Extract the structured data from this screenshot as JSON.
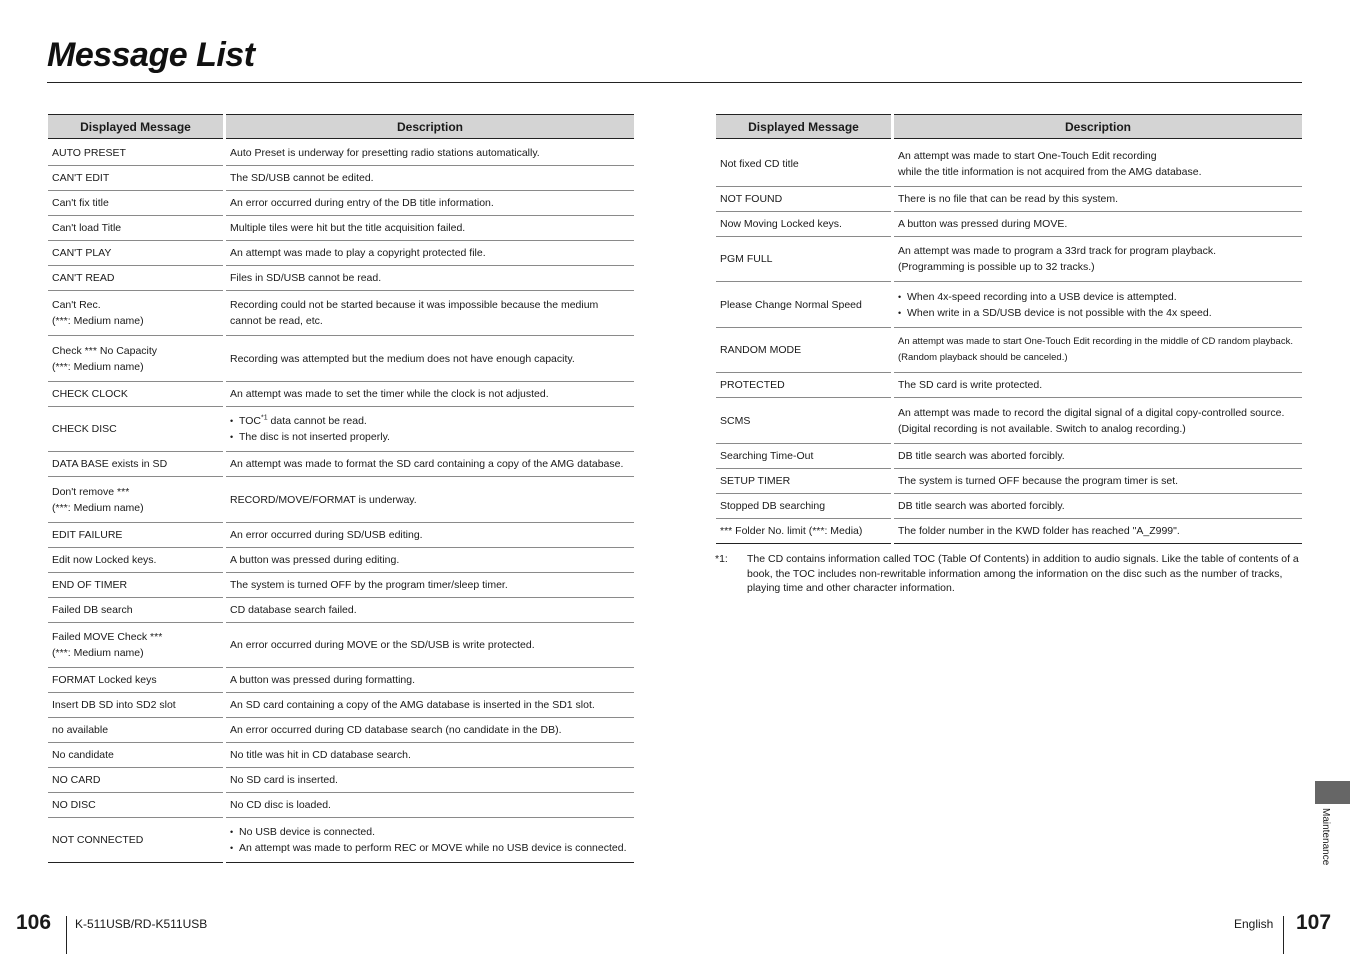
{
  "page": {
    "title": "Message List"
  },
  "table_headers": {
    "message": "Displayed Message",
    "description": "Description"
  },
  "left_table": [
    {
      "message": [
        "AUTO PRESET"
      ],
      "description": [
        "Auto Preset is underway for presetting radio stations automatically."
      ]
    },
    {
      "message": [
        "CAN'T EDIT"
      ],
      "description": [
        "The SD/USB cannot be edited."
      ]
    },
    {
      "message": [
        "Can't fix title"
      ],
      "description": [
        "An error occurred during entry of the DB title information."
      ]
    },
    {
      "message": [
        "Can't load Title"
      ],
      "description": [
        "Multiple tiles were hit but the title acquisition failed."
      ]
    },
    {
      "message": [
        "CAN'T PLAY"
      ],
      "description": [
        "An attempt was made to play a copyright protected file."
      ]
    },
    {
      "message": [
        "CAN'T READ"
      ],
      "description": [
        "Files in SD/USB cannot be read."
      ]
    },
    {
      "message": [
        "Can't Rec.",
        "(***: Medium name)"
      ],
      "description": [
        "Recording could not be started because it was impossible because the medium",
        "cannot be read, etc."
      ]
    },
    {
      "message": [
        "Check *** No Capacity",
        "(***: Medium name)"
      ],
      "description": [
        "Recording was attempted but the medium does not have enough capacity."
      ]
    },
    {
      "message": [
        "CHECK CLOCK"
      ],
      "description": [
        "An attempt was made to set the timer while the clock is not adjusted."
      ]
    },
    {
      "message": [
        "CHECK DISC"
      ],
      "bullets": true,
      "description": [
        "TOC|*1| data cannot be read.",
        "The disc is not inserted properly."
      ]
    },
    {
      "message": [
        "DATA BASE exists in SD"
      ],
      "description": [
        "An attempt was made to format the SD card containing a copy of the AMG database."
      ]
    },
    {
      "message": [
        "Don't remove ***",
        "(***: Medium name)"
      ],
      "description": [
        "RECORD/MOVE/FORMAT is underway."
      ]
    },
    {
      "message": [
        "EDIT FAILURE"
      ],
      "description": [
        "An error occurred during SD/USB editing."
      ]
    },
    {
      "message": [
        "Edit now Locked keys."
      ],
      "description": [
        "A button was pressed during editing."
      ]
    },
    {
      "message": [
        "END OF TIMER"
      ],
      "description": [
        "The system is turned OFF by the program timer/sleep timer."
      ]
    },
    {
      "message": [
        "Failed DB search"
      ],
      "description": [
        "CD database search failed."
      ]
    },
    {
      "message": [
        "Failed MOVE Check ***",
        "(***: Medium name)"
      ],
      "description": [
        "An error occurred during MOVE or the SD/USB is write protected."
      ]
    },
    {
      "message": [
        "FORMAT Locked keys"
      ],
      "description": [
        "A button was pressed during formatting."
      ]
    },
    {
      "message": [
        "Insert DB SD into SD2 slot"
      ],
      "description": [
        "An SD card containing a copy of the AMG database is inserted in the SD1 slot."
      ]
    },
    {
      "message": [
        "no available"
      ],
      "description": [
        "An error occurred during CD database search (no candidate in the DB)."
      ]
    },
    {
      "message": [
        "No candidate"
      ],
      "description": [
        "No title was hit in CD database search."
      ]
    },
    {
      "message": [
        "NO CARD"
      ],
      "description": [
        "No SD card is inserted."
      ]
    },
    {
      "message": [
        "NO DISC"
      ],
      "description": [
        "No CD disc is loaded."
      ]
    },
    {
      "message": [
        "NOT CONNECTED"
      ],
      "bullets": true,
      "description": [
        "No USB device is connected.",
        "An attempt was made to perform REC or MOVE while no USB device is connected."
      ]
    }
  ],
  "right_table": [
    {
      "message": [
        "Not fixed CD title"
      ],
      "description": [
        "An attempt was made to start One-Touch Edit recording",
        "while the title information is not acquired from the AMG database."
      ]
    },
    {
      "message": [
        "NOT FOUND"
      ],
      "description": [
        "There is no file that can be read by this system."
      ]
    },
    {
      "message": [
        "Now Moving Locked keys."
      ],
      "description": [
        "A button was pressed during MOVE."
      ]
    },
    {
      "message": [
        "PGM FULL"
      ],
      "description": [
        "An attempt was made to program a 33rd track for program playback.",
        "(Programming is possible up to 32 tracks.)"
      ]
    },
    {
      "message": [
        "Please Change Normal Speed"
      ],
      "bullets": true,
      "description": [
        "When 4x-speed recording into a USB device is attempted.",
        "When write in a SD/USB device is not possible with the 4x speed."
      ]
    },
    {
      "message": [
        "RANDOM MODE"
      ],
      "small": true,
      "description": [
        "An attempt was made to start One-Touch Edit recording in the middle of CD random playback.",
        "(Random playback should be canceled.)"
      ]
    },
    {
      "message": [
        "PROTECTED"
      ],
      "description": [
        "The SD card is write protected."
      ]
    },
    {
      "message": [
        "SCMS"
      ],
      "description": [
        "An attempt was made to record the digital signal of a digital copy-controlled source.",
        "(Digital recording is not available. Switch to analog recording.)"
      ]
    },
    {
      "message": [
        "Searching Time-Out"
      ],
      "description": [
        "DB title search was aborted forcibly."
      ]
    },
    {
      "message": [
        "SETUP TIMER"
      ],
      "description": [
        "The system is turned OFF because the program timer is set."
      ]
    },
    {
      "message": [
        "Stopped DB searching"
      ],
      "description": [
        "DB title search was aborted forcibly."
      ]
    },
    {
      "message": [
        "*** Folder No. limit (***: Media)"
      ],
      "description": [
        "The folder number in the KWD folder has reached \"A_Z999\"."
      ]
    }
  ],
  "footnote": {
    "mark": "*1:",
    "text": "The CD contains information called TOC (Table Of Contents) in addition to audio signals. Like the table of contents of a book, the TOC includes non-rewritable information among the information on the disc such as the number of tracks, playing time and other character information."
  },
  "footer": {
    "left_page": "106",
    "model": "K-511USB/RD-K511USB",
    "language": "English",
    "right_page": "107",
    "section_tab": "Maintenance"
  }
}
